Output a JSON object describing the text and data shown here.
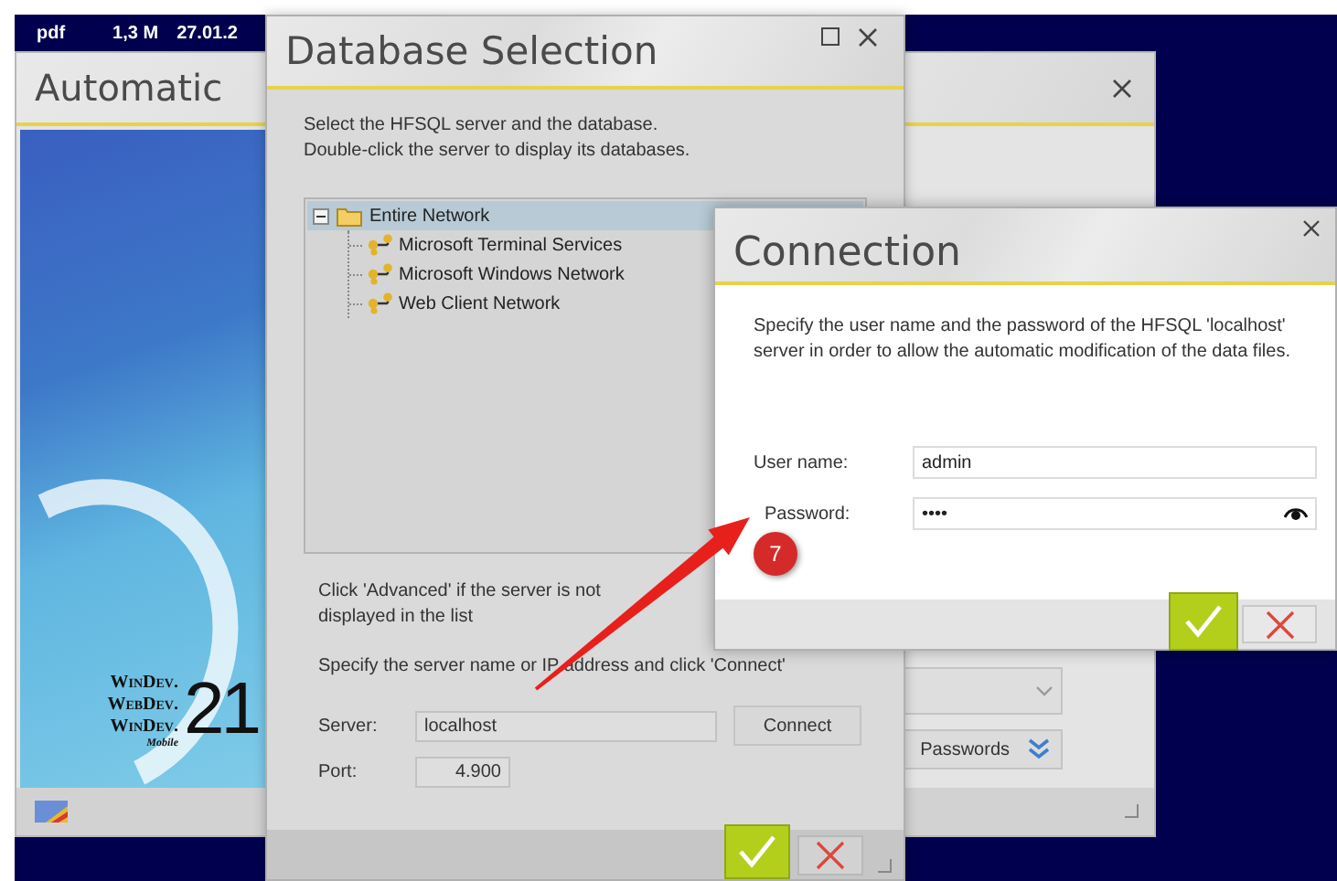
{
  "file_row": {
    "type": "pdf",
    "size": "1,3 M",
    "date": "27.01.2"
  },
  "back_window": {
    "title": "Automatic",
    "logo": {
      "lines": [
        "WinDev.",
        "WebDev.",
        "WinDev."
      ],
      "subtitle": "Mobile",
      "version": "21"
    },
    "passwords_button": "Passwords"
  },
  "database_selection": {
    "title": "Database Selection",
    "instructions": [
      "Select the HFSQL server and the database.",
      "Double-click the server to display its databases."
    ],
    "tree": [
      {
        "label": "Entire Network",
        "expanded": true,
        "selected": true,
        "children": [
          {
            "label": "Microsoft Terminal Services",
            "selected": false
          },
          {
            "label": "Microsoft Windows Network",
            "selected": false
          },
          {
            "label": "Web Client Network",
            "selected": false
          }
        ]
      }
    ],
    "advanced_note": "Click 'Advanced' if the server is not displayed in the list",
    "specify_note": "Specify the server name or IP address and click 'Connect'",
    "server": {
      "label": "Server:",
      "value": "localhost"
    },
    "connect_button": "Connect",
    "port": {
      "label": "Port:",
      "value": "4.900"
    }
  },
  "connection": {
    "title": "Connection",
    "message": "Specify the user name and the password of the HFSQL 'localhost' server in order to allow the automatic modification of the data files.",
    "user_name": {
      "label": "User name:",
      "value": "admin"
    },
    "password": {
      "label": "Password:",
      "value": "••••"
    }
  },
  "annotation": {
    "number": "7"
  }
}
